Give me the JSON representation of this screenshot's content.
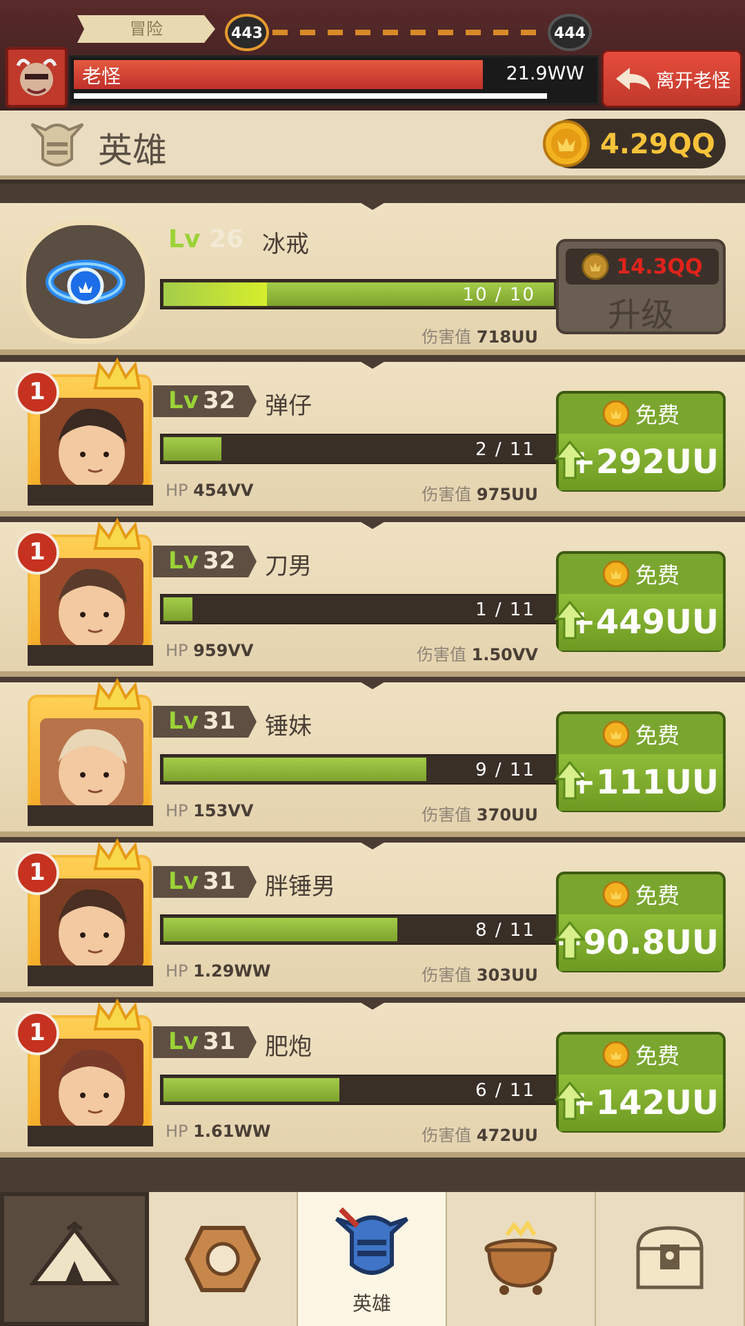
{
  "top_bar": {
    "stage_tag": "冒险",
    "current_stage": "443",
    "next_stage": "444",
    "boss_name": "老怪",
    "boss_hp": "21.9WW",
    "boss_hp_fraction": 0.78,
    "leave_button": "离开老怪"
  },
  "header": {
    "title": "英雄",
    "coin_total": "4.29QQ"
  },
  "ring": {
    "lv_label": "Lv",
    "level": "26",
    "name": "冰戒",
    "progress_text": "10 / 10",
    "progress_fraction": 1.0,
    "damage_label": "伤害值",
    "damage_value": "718UU",
    "upgrade_cost": "14.3QQ",
    "upgrade_label": "升级"
  },
  "heroes": [
    {
      "rank": "1",
      "lv_label": "Lv",
      "level": "32",
      "name": "弹仔",
      "progress_text": "2 / 11",
      "progress_fraction": 0.18,
      "hp_label": "HP",
      "hp_value": "454VV",
      "damage_label": "伤害值",
      "damage_value": "975UU",
      "free_label": "免费",
      "gain": "+292UU"
    },
    {
      "rank": "1",
      "lv_label": "Lv",
      "level": "32",
      "name": "刀男",
      "progress_text": "1 / 11",
      "progress_fraction": 0.09,
      "hp_label": "HP",
      "hp_value": "959VV",
      "damage_label": "伤害值",
      "damage_value": "1.50VV",
      "free_label": "免费",
      "gain": "+449UU"
    },
    {
      "rank": "",
      "lv_label": "Lv",
      "level": "31",
      "name": "锤妹",
      "progress_text": "9 / 11",
      "progress_fraction": 0.82,
      "hp_label": "HP",
      "hp_value": "153VV",
      "damage_label": "伤害值",
      "damage_value": "370UU",
      "free_label": "免费",
      "gain": "+111UU"
    },
    {
      "rank": "1",
      "lv_label": "Lv",
      "level": "31",
      "name": "胖锤男",
      "progress_text": "8 / 11",
      "progress_fraction": 0.73,
      "hp_label": "HP",
      "hp_value": "1.29WW",
      "damage_label": "伤害值",
      "damage_value": "303UU",
      "free_label": "免费",
      "gain": "+90.8UU"
    },
    {
      "rank": "1",
      "lv_label": "Lv",
      "level": "31",
      "name": "肥炮",
      "progress_text": "6 / 11",
      "progress_fraction": 0.55,
      "hp_label": "HP",
      "hp_value": "1.61WW",
      "damage_label": "伤害值",
      "damage_value": "472UU",
      "free_label": "免费",
      "gain": "+142UU"
    }
  ],
  "bottom_nav": {
    "items": [
      {
        "icon": "camp-tent-icon"
      },
      {
        "icon": "artifact-stone-icon"
      },
      {
        "icon": "hero-helmet-icon",
        "label": "英雄"
      },
      {
        "icon": "cauldron-icon"
      },
      {
        "icon": "treasure-chest-icon"
      }
    ]
  },
  "colors": {
    "accent_green": "#7ea32c",
    "boss_red": "#c0392b",
    "gold": "#f7c33a"
  }
}
